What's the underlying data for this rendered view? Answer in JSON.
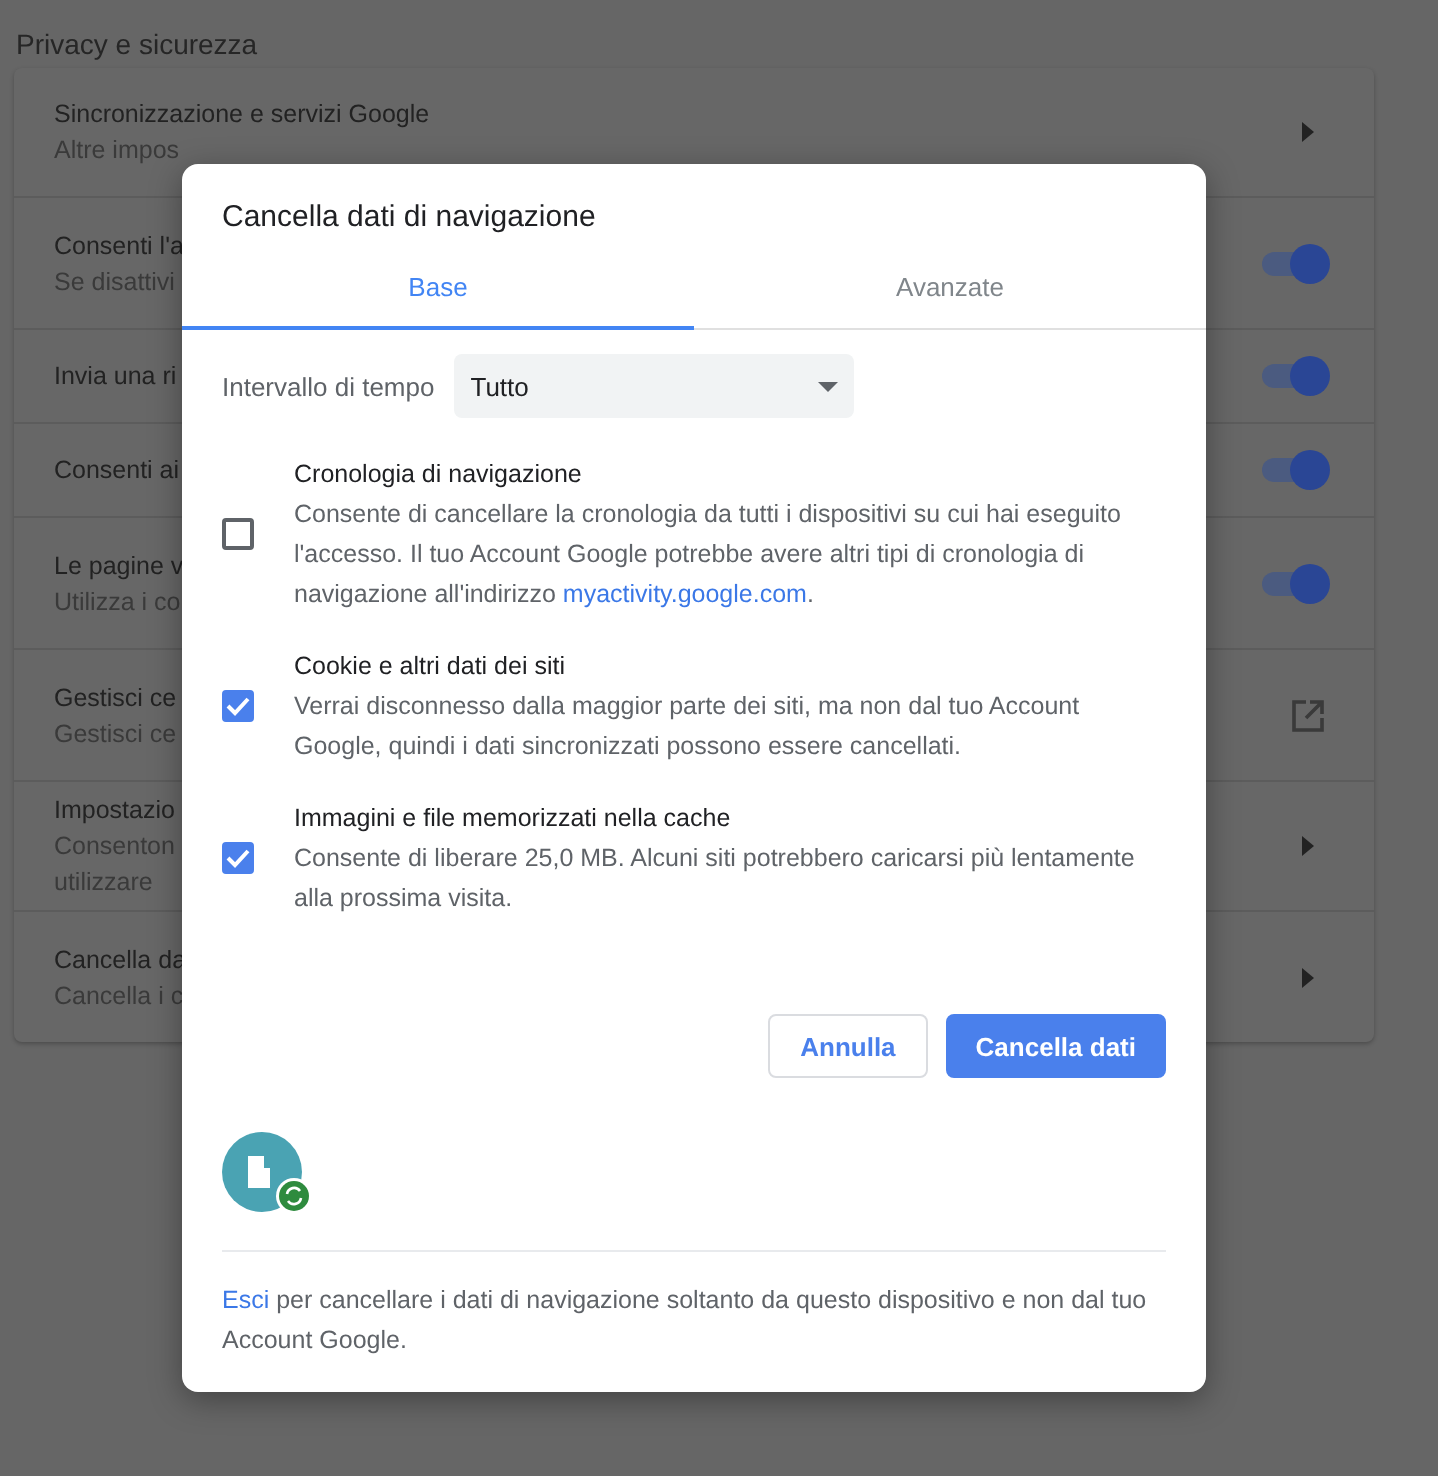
{
  "page": {
    "title": "Privacy e sicurezza"
  },
  "settings": [
    {
      "title": "Sincronizzazione e servizi Google",
      "subtitle": "Altre impos",
      "kind": "arrow"
    },
    {
      "title": "Consenti l'a",
      "subtitle": "Se disattivi",
      "kind": "toggle",
      "on": true
    },
    {
      "title": "Invia una ri",
      "kind": "toggle",
      "on": true
    },
    {
      "title": "Consenti ai",
      "kind": "toggle",
      "on": true
    },
    {
      "title": "Le pagine v",
      "subtitle": "Utilizza i co",
      "kind": "toggle",
      "on": true
    },
    {
      "title": "Gestisci ce",
      "subtitle": "Gestisci ce",
      "kind": "external"
    },
    {
      "title": "Impostazio",
      "subtitle": "Consenton",
      "subtitle_2": "utilizzare",
      "kind": "arrow"
    },
    {
      "title": "Cancella da",
      "subtitle": "Cancella i c",
      "kind": "arrow"
    }
  ],
  "dialog": {
    "title": "Cancella dati di navigazione",
    "tabs": [
      {
        "label": "Base",
        "selected": true
      },
      {
        "label": "Avanzate",
        "selected": false
      }
    ],
    "time_range": {
      "label": "Intervallo di tempo",
      "value": "Tutto"
    },
    "options": [
      {
        "title": "Cronologia di navigazione",
        "description": "Consente di cancellare la cronologia da tutti i dispositivi su cui hai eseguito l'accesso. Il tuo Account Google potrebbe avere altri tipi di cronologia di navigazione all'indirizzo",
        "link": "myactivity.google.com",
        "suffix": ".",
        "checked": false
      },
      {
        "title": "Cookie e altri dati dei siti",
        "description": "Verrai disconnesso dalla maggior parte dei siti, ma non dal tuo Account Google, quindi i dati sincronizzati possono essere cancellati.",
        "checked": true
      },
      {
        "title": "Immagini e file memorizzati nella cache",
        "description": "Consente di liberare 25,0 MB. Alcuni siti potrebbero caricarsi più lentamente alla prossima visita.",
        "checked": true
      }
    ],
    "buttons": {
      "cancel": "Annulla",
      "confirm": "Cancella dati"
    },
    "footer": {
      "link": "Esci",
      "text": "per cancellare i dati di navigazione soltanto da questo dispositivo e non dal tuo Account Google."
    }
  }
}
